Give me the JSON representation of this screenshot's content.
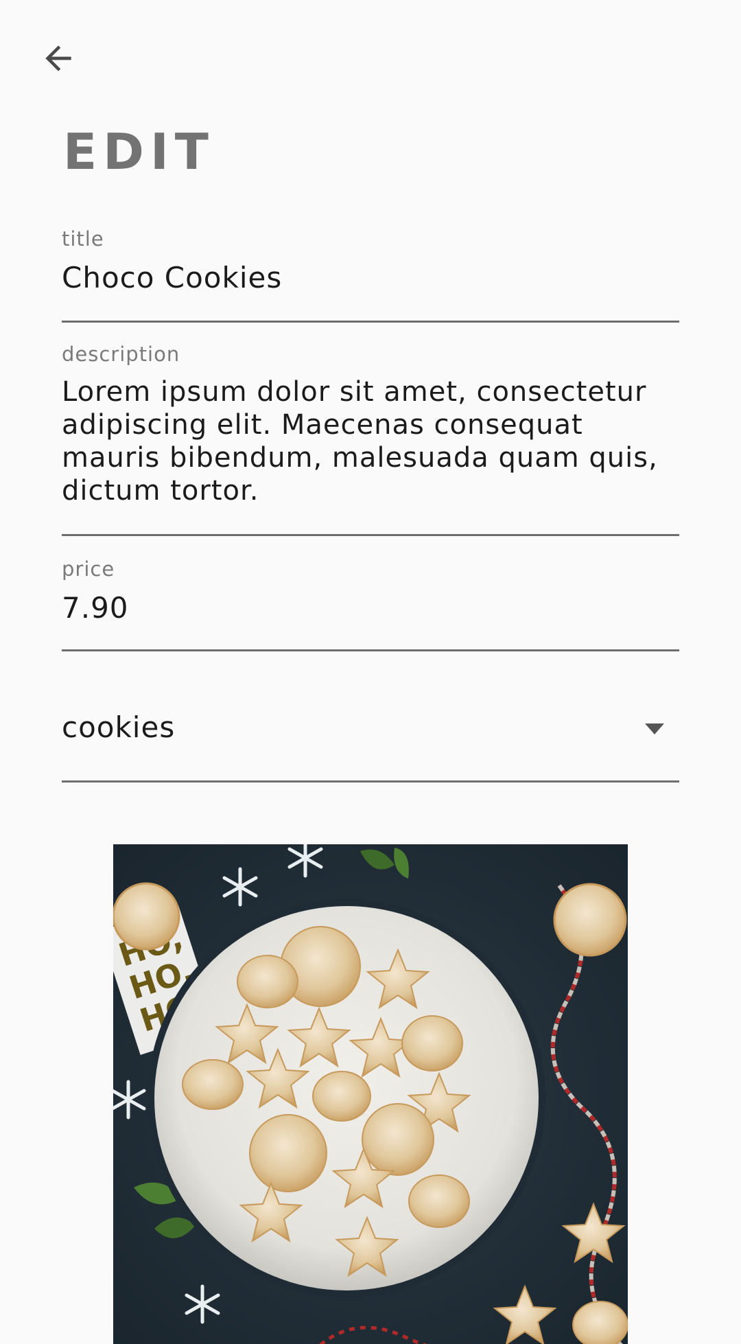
{
  "header": {
    "back_icon": "arrow-back-icon",
    "title": "EDIT"
  },
  "form": {
    "title": {
      "label": "title",
      "value": "Choco Cookies"
    },
    "description": {
      "label": "description",
      "value": "Lorem ipsum dolor sit amet, consectetur adipiscing elit. Maecenas consequat mauris bibendum, malesuada quam quis, dictum tortor."
    },
    "price": {
      "label": "price",
      "value": "7.90"
    },
    "category": {
      "selected": "cookies",
      "icon": "dropdown-arrow-icon"
    }
  },
  "image": {
    "tag_text": "HO, HO, HO",
    "subject": "cookies-on-plate-photo"
  },
  "colors": {
    "background": "#fafafa",
    "title_gray": "#737373",
    "label_gray": "#7a7a7a",
    "underline": "#6e6e6e",
    "text": "#1b1b1b"
  }
}
